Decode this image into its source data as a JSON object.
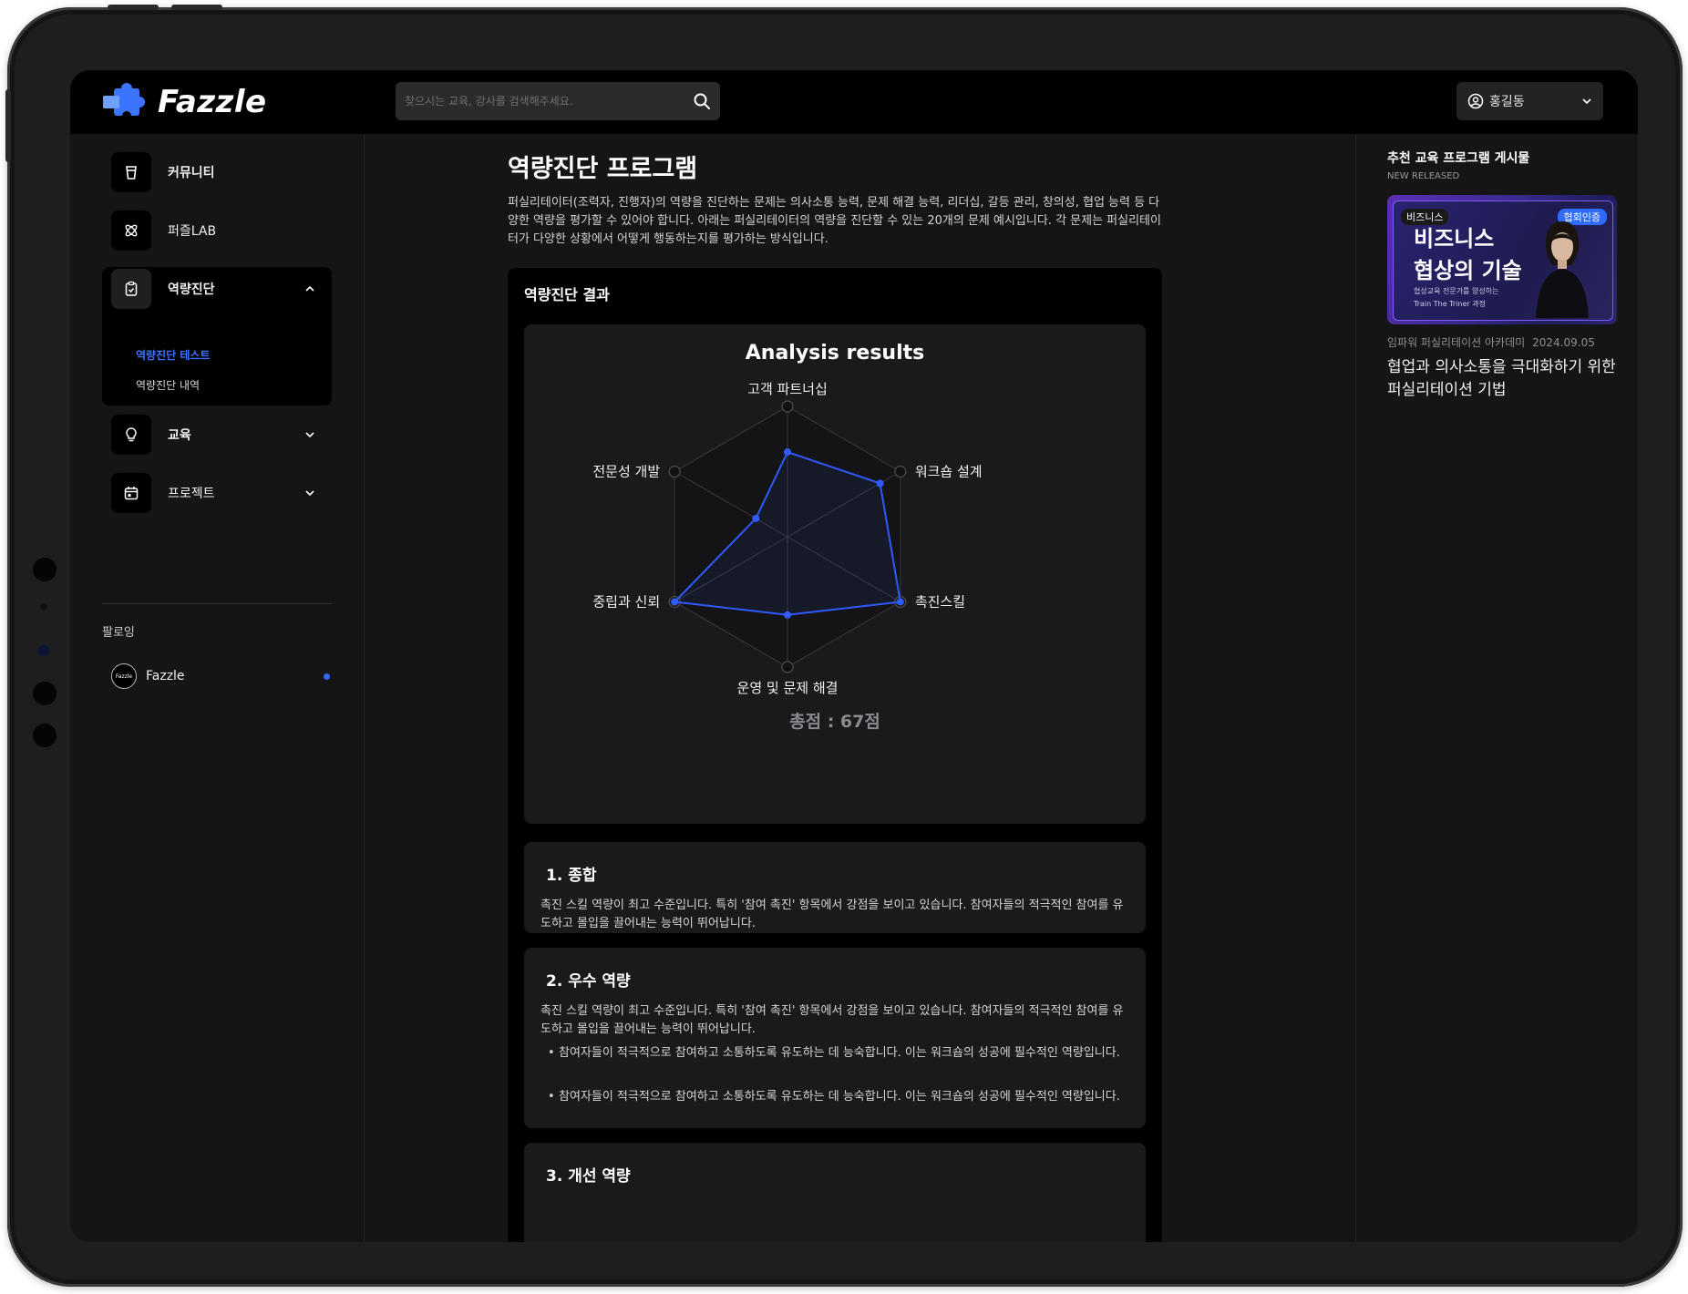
{
  "app": {
    "brand": "Fazzle"
  },
  "search": {
    "placeholder": "찾으시는 교육, 강사를 검색해주세요."
  },
  "user": {
    "name": "홍길동"
  },
  "sidebar": {
    "items": [
      {
        "label": "커뮤니티",
        "icon": "cup-icon"
      },
      {
        "label": "퍼즐LAB",
        "icon": "atom-icon"
      },
      {
        "label": "역량진단",
        "icon": "clipboard-icon"
      },
      {
        "label": "교육",
        "icon": "bulb-icon"
      },
      {
        "label": "프로젝트",
        "icon": "calendar-icon"
      }
    ],
    "sub_items": [
      {
        "label": "역량진단 테스트",
        "active": true
      },
      {
        "label": "역량진단 내역",
        "active": false
      }
    ],
    "follow_title": "팔로잉",
    "follow": [
      {
        "name": "Fazzle",
        "avatar_text": "Fazzle"
      }
    ]
  },
  "main": {
    "title": "역량진단 프로그램",
    "description": "퍼실리테이터(조력자, 진행자)의 역량을 진단하는 문제는 의사소통 능력, 문제 해결 능력, 리더십, 갈등 관리, 창의성, 협업 능력 등 다양한 역량을 평가할 수 있어야 합니다. 아래는 퍼실리테이터의 역량을 진단할 수 있는 20개의 문제 예시입니다. 각 문제는 퍼실리테이터가 다양한 상황에서 어떻게 행동하는지를 평가하는 방식입니다.",
    "result_title": "역량진단 결과",
    "total_score": "총점 : 67점",
    "sections": [
      {
        "title": "1. 종합",
        "body": "촉진 스킬 역량이 최고 수준입니다. 특히 '참여 촉진' 항목에서 강점을 보이고 있습니다. 참여자들의 적극적인 참여를 유도하고 몰입을 끌어내는 능력이 뛰어납니다."
      },
      {
        "title": "2. 우수 역량",
        "body": "촉진 스킬 역량이 최고 수준입니다. 특히 '참여 촉진' 항목에서 강점을 보이고 있습니다. 참여자들의 적극적인 참여를 유도하고 몰입을 끌어내는 능력이 뛰어납니다.",
        "bullets": [
          "참여자들이 적극적으로 참여하고 소통하도록 유도하는 데 능숙합니다. 이는 워크숍의 성공에 필수적인 역량입니다.",
          "참여자들이 적극적으로 참여하고 소통하도록 유도하는 데 능숙합니다. 이는 워크숍의 성공에 필수적인 역량입니다."
        ]
      },
      {
        "title": "3. 개선 역량"
      }
    ]
  },
  "chart_data": {
    "type": "radar",
    "title": "Analysis results",
    "categories": [
      "고객 파트너십",
      "워크숍 설계",
      "촉진스킬",
      "운영 및 문제 해결",
      "중립과 신뢰",
      "전문성 개발"
    ],
    "values": [
      0.65,
      0.82,
      1.0,
      0.6,
      1.0,
      0.28
    ],
    "rmax": 1,
    "grid_levels": 5,
    "color": "#2f5bff"
  },
  "right_panel": {
    "title": "추천 교육 프로그램 게시물",
    "subtitle": "NEW RELEASED",
    "banner": {
      "tag": "비즈니스",
      "cert": "협회인증",
      "line1": "비즈니스",
      "line2": "협상의 기술",
      "sub1": "협상교육 전문가를 양성하는",
      "sub2": "Train The Triner 과정"
    },
    "article": {
      "publisher": "임파워 퍼실리테이션 아카데미",
      "date": "2024.09.05",
      "title": "협업과 의사소통을 극대화하기 위한 퍼실리테이션 기법"
    }
  }
}
